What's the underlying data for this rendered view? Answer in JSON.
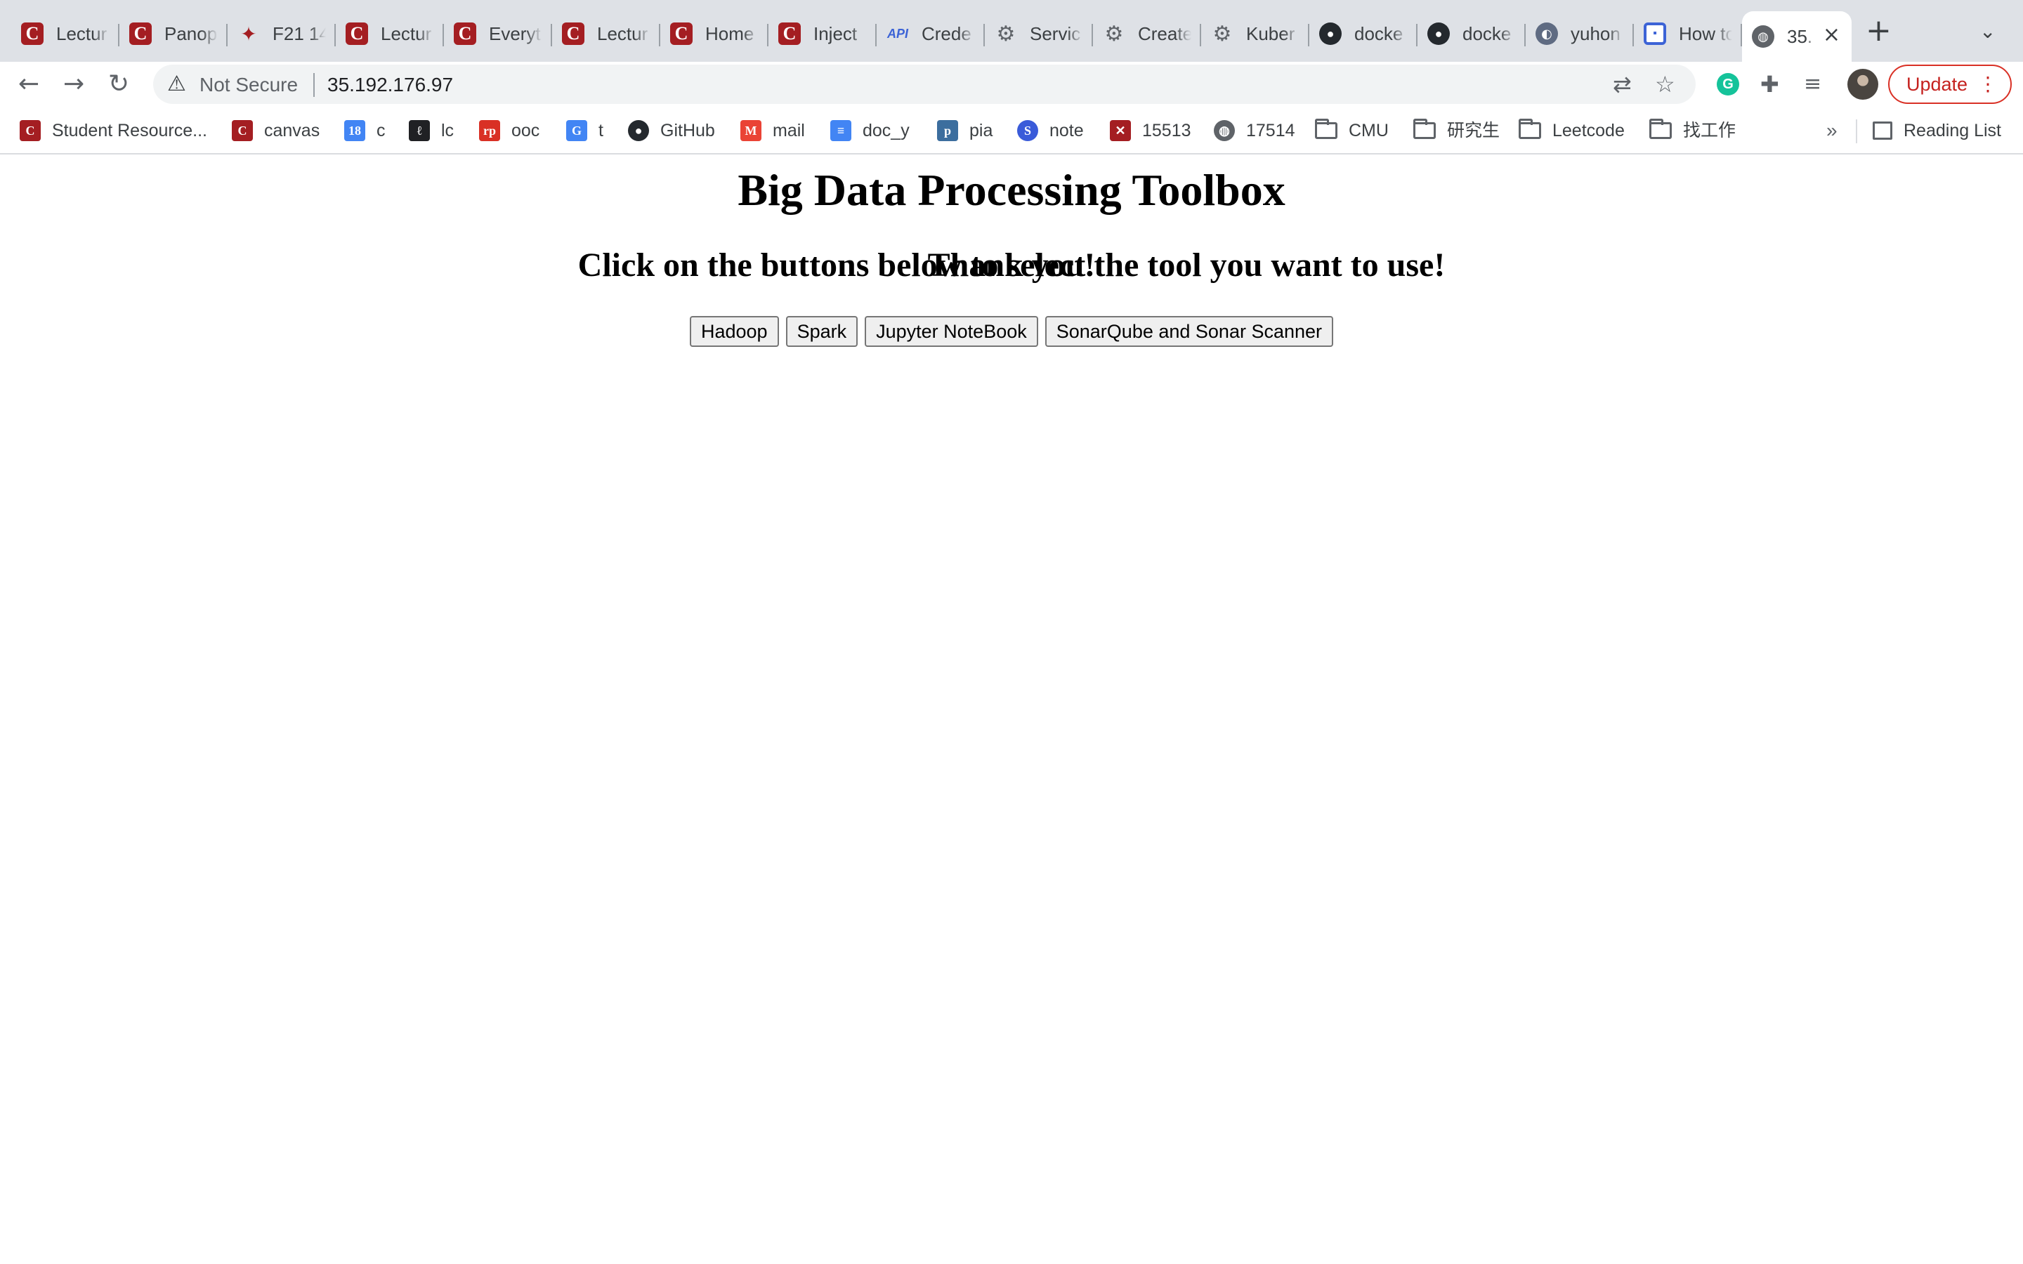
{
  "browser": {
    "tabs": [
      {
        "title": "Lectur",
        "icon": "cmu-icon"
      },
      {
        "title": "Panop",
        "icon": "cmu-icon"
      },
      {
        "title": "F21 14",
        "icon": "compass-icon"
      },
      {
        "title": "Lectur",
        "icon": "cmu-icon"
      },
      {
        "title": "Everyt",
        "icon": "cmu-icon"
      },
      {
        "title": "Lectur",
        "icon": "cmu-icon"
      },
      {
        "title": "Home",
        "icon": "cmu-icon"
      },
      {
        "title": "Inject",
        "icon": "cmu-icon"
      },
      {
        "title": "Crede",
        "icon": "api-icon"
      },
      {
        "title": "Servic",
        "icon": "gear-icon"
      },
      {
        "title": "Create",
        "icon": "gear-icon"
      },
      {
        "title": "Kuber",
        "icon": "gear-icon"
      },
      {
        "title": "docke",
        "icon": "github-icon"
      },
      {
        "title": "docke",
        "icon": "github-icon"
      },
      {
        "title": "yuhon",
        "icon": "penguin-icon"
      },
      {
        "title": "How to",
        "icon": "doc-icon"
      },
      {
        "title": "35.",
        "icon": "globe-icon"
      }
    ],
    "address_bar": {
      "security_label": "Not Secure",
      "url": "35.192.176.97"
    },
    "update_label": "Update",
    "bookmarks": [
      {
        "label": "Student Resource...",
        "icon": "cmu-icon"
      },
      {
        "label": "canvas",
        "icon": "cmu-icon"
      },
      {
        "label": "c",
        "icon": "calendar-icon"
      },
      {
        "label": "lc",
        "icon": "leetcode-icon"
      },
      {
        "label": "ooc",
        "icon": "rp-icon"
      },
      {
        "label": "t",
        "icon": "translate-icon"
      },
      {
        "label": "GitHub",
        "icon": "github-icon"
      },
      {
        "label": "mail",
        "icon": "gmail-icon"
      },
      {
        "label": "doc_y",
        "icon": "docs-icon"
      },
      {
        "label": "pia",
        "icon": "pia-icon"
      },
      {
        "label": "note",
        "icon": "note-icon"
      },
      {
        "label": "15513",
        "icon": "bird-icon"
      },
      {
        "label": "17514",
        "icon": "globe-icon"
      },
      {
        "label": "CMU",
        "icon": "folder-icon"
      },
      {
        "label": "研究生",
        "icon": "folder-icon"
      },
      {
        "label": "Leetcode",
        "icon": "folder-icon"
      },
      {
        "label": "找工作",
        "icon": "folder-icon"
      }
    ],
    "more_bookmarks": "»",
    "reading_list": "Reading List",
    "colors": {
      "tab_strip": "#dee1e6",
      "update_red": "#d93025",
      "cmu_red": "#a41e22"
    }
  },
  "page": {
    "title": "Big Data Processing Toolbox",
    "instructions": "Click on the buttons below to select the tool you want to use!",
    "buttons": {
      "hadoop": "Hadoop",
      "spark": "Spark",
      "jupyter": "Jupyter NoteBook",
      "sonar": "SonarQube and Sonar Scanner"
    },
    "footer": "Thank you!"
  }
}
